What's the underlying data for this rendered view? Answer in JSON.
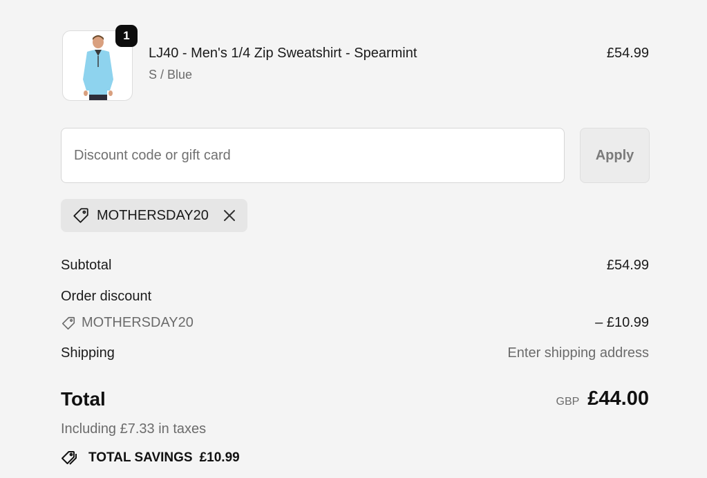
{
  "product": {
    "quantity": "1",
    "title": "LJ40 - Men's 1/4 Zip Sweatshirt - Spearmint",
    "variant": "S / Blue",
    "price": "£54.99",
    "image_icon": "product-thumbnail"
  },
  "discount": {
    "placeholder": "Discount code or gift card",
    "value": "",
    "apply_label": "Apply",
    "applied_code": "MOTHERSDAY20"
  },
  "summary": {
    "subtotal_label": "Subtotal",
    "subtotal_value": "£54.99",
    "order_discount_label": "Order discount",
    "discount_code": "MOTHERSDAY20",
    "discount_value": "– £10.99",
    "shipping_label": "Shipping",
    "shipping_value": "Enter shipping address",
    "total_label": "Total",
    "currency": "GBP",
    "total_value": "£44.00",
    "taxes_note": "Including £7.33 in taxes",
    "savings_label": "TOTAL SAVINGS",
    "savings_value": "£10.99"
  },
  "colors": {
    "background": "#f4f4f4",
    "text": "#1a1a1a",
    "muted": "#6b6b6b",
    "chip": "#e6e6e6",
    "badge": "#0d0d0d"
  }
}
